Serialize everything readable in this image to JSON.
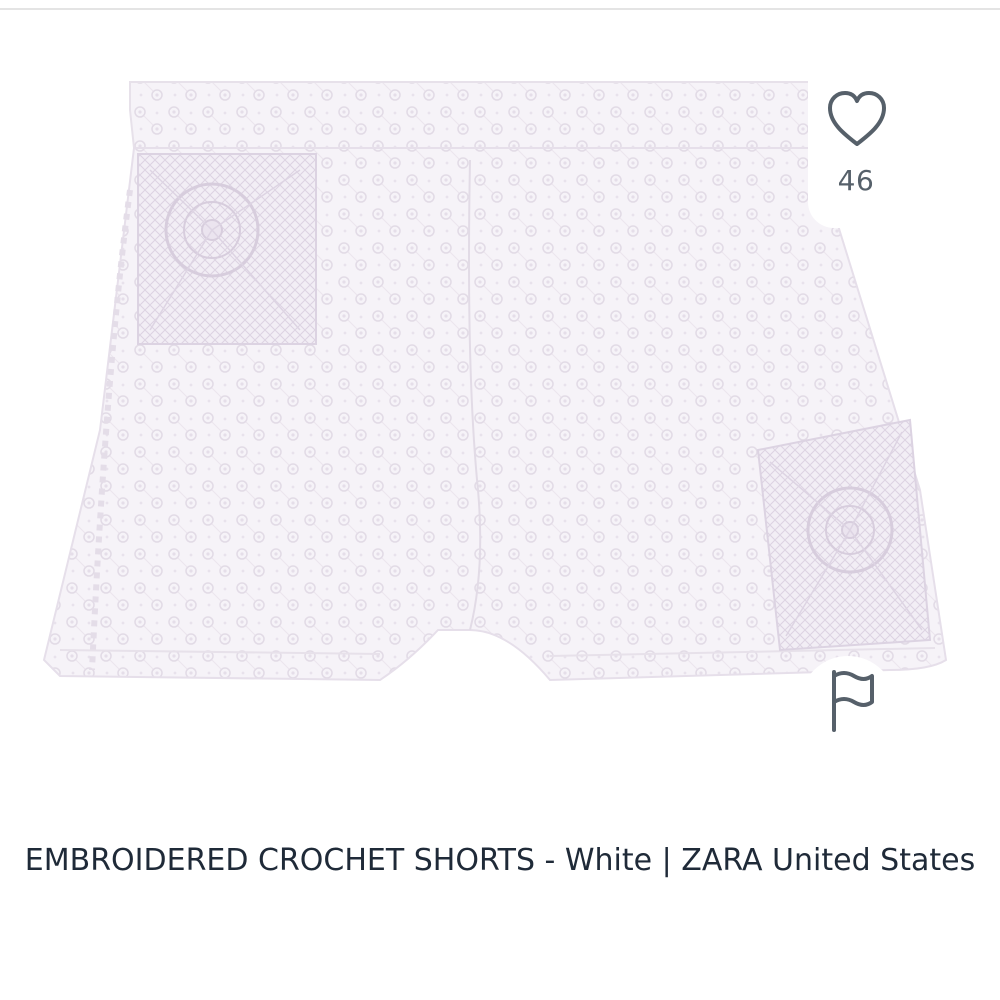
{
  "product": {
    "title": "EMBROIDERED CROCHET SHORTS - White | ZARA United States",
    "image_alt": "White embroidered eyelet shorts with crochet square patches"
  },
  "actions": {
    "like_count": "46",
    "like_icon": "heart-outline-icon",
    "report_icon": "flag-outline-icon"
  },
  "colors": {
    "icon": "#56606a",
    "title": "#1f2a38",
    "background": "#ffffff"
  }
}
